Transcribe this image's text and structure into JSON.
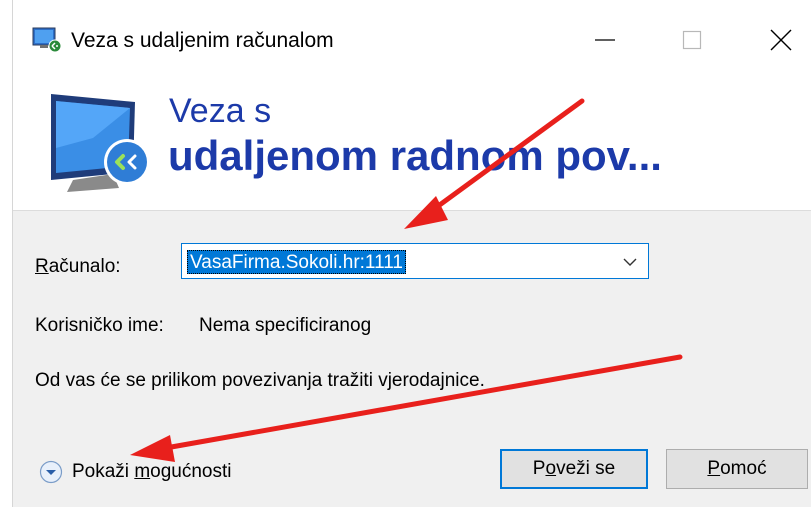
{
  "window": {
    "title": "Veza s udaljenim računalom",
    "controls": {
      "minimize": "minimize-icon",
      "maximize": "maximize-icon",
      "close": "close-icon"
    }
  },
  "banner": {
    "line1": "Veza s",
    "line2": "udaljenom radnom pov..."
  },
  "form": {
    "computer_label_accel": "R",
    "computer_label_rest": "ačunalo:",
    "computer_value": "VasaFirma.Sokoli.hr:1111",
    "username_label": "Korisničko ime:",
    "username_value": "Nema specificiranog",
    "info_text": "Od vas će se prilikom povezivanja tražiti vjerodajnice."
  },
  "footer": {
    "options_prefix": "Pokaži ",
    "options_accel": "m",
    "options_rest": "ogućnosti",
    "connect_prefix": "P",
    "connect_accel": "o",
    "connect_rest": "veži se",
    "help_accel": "P",
    "help_rest": "omoć"
  },
  "colors": {
    "banner_text": "#1c3aa9",
    "selection": "#0078d7",
    "annotation_arrow": "#e8201c"
  }
}
